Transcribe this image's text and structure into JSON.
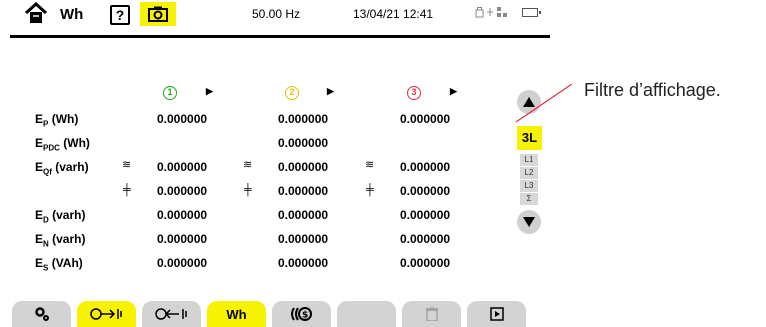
{
  "header": {
    "title": "Wh",
    "help_label": "?",
    "frequency": "50.00 Hz",
    "datetime": "13/04/21 12:41"
  },
  "phases": [
    {
      "label": "1",
      "color": "#1ea81e"
    },
    {
      "label": "2",
      "color": "#e0c400"
    },
    {
      "label": "3",
      "color": "#e0304a"
    }
  ],
  "rows": [
    {
      "label": "EP (Wh)",
      "main": "E",
      "sub": "P",
      "unit": " (Wh)",
      "values": [
        "0.000000",
        "0.000000",
        "0.000000"
      ]
    },
    {
      "label": "EPDC (Wh)",
      "main": "E",
      "sub": "PDC",
      "unit": " (Wh)",
      "values": [
        "",
        "0.000000",
        ""
      ]
    },
    {
      "label": "EQf (varh)",
      "main": "E",
      "sub": "Qf",
      "unit": " (varh)",
      "values": [
        "0.000000",
        "0.000000",
        "0.000000"
      ]
    },
    {
      "label": "",
      "main": "",
      "sub": "",
      "unit": "",
      "values": [
        "0.000000",
        "0.000000",
        "0.000000"
      ]
    },
    {
      "label": "ED (varh)",
      "main": "E",
      "sub": "D",
      "unit": " (varh)",
      "values": [
        "0.000000",
        "0.000000",
        "0.000000"
      ]
    },
    {
      "label": "EN (varh)",
      "main": "E",
      "sub": "N",
      "unit": " (varh)",
      "values": [
        "0.000000",
        "0.000000",
        "0.000000"
      ]
    },
    {
      "label": "ES (VAh)",
      "main": "E",
      "sub": "S",
      "unit": " (VAh)",
      "values": [
        "0.000000",
        "0.000000",
        "0.000000"
      ]
    }
  ],
  "filter": {
    "selected": "3L",
    "options": [
      "L1",
      "L2",
      "L3",
      "Σ"
    ]
  },
  "bottom_tabs": [
    {
      "name": "settings",
      "label": "",
      "active": false
    },
    {
      "name": "energy-consumed",
      "label": "",
      "active": true
    },
    {
      "name": "energy-generated",
      "label": "",
      "active": false
    },
    {
      "name": "wh",
      "label": "Wh",
      "active": true
    },
    {
      "name": "cost",
      "label": "",
      "active": false
    },
    {
      "name": "blank",
      "label": "",
      "active": false
    },
    {
      "name": "trash",
      "label": "",
      "active": false
    },
    {
      "name": "start",
      "label": "",
      "active": false
    }
  ],
  "annotation": "Filtre d’affichage."
}
